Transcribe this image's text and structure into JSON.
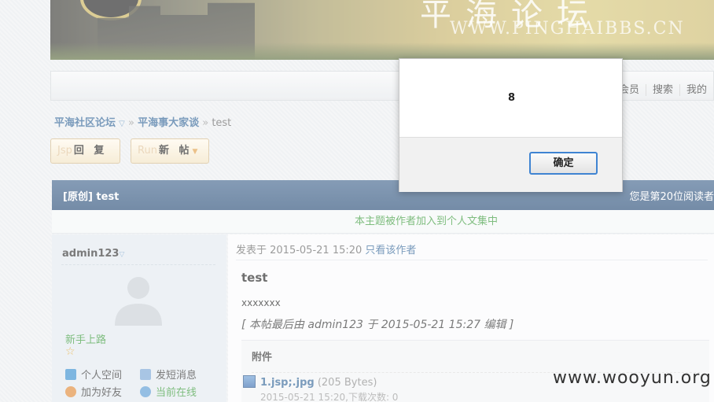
{
  "banner": {
    "site_url": "WWW.PINGHAIBBS.CN",
    "logo_text": "平海论坛"
  },
  "navbar": {
    "links": [
      "会员",
      "搜索",
      "我的"
    ]
  },
  "breadcrumb": {
    "forum": "平海社区论坛",
    "sep1": " » ",
    "board": "平海事大家谈",
    "sep2": " » ",
    "current": "test"
  },
  "buttons": {
    "reply": {
      "prefix": "Jsp",
      "label": "回 复"
    },
    "new_post": {
      "prefix": "Run",
      "label": "新 帖"
    }
  },
  "topic": {
    "title": "[原创] test",
    "reader_info": "您是第20位阅读者"
  },
  "notice": "本主题被作者加入到个人文集中",
  "author": {
    "name": "admin123",
    "rank": "新手上路",
    "actions": [
      "个人空间",
      "发短消息",
      "加为好友",
      "当前在线"
    ]
  },
  "post": {
    "posted_at": "发表于 2015-05-21 15:20",
    "only_author_link": "只看该作者",
    "title": "test",
    "body": "xxxxxxx",
    "edit_note": "[ 本帖最后由 admin123 于 2015-05-21  15:27 编辑 ]",
    "attachments_heading": "附件",
    "attachment": {
      "filename": "1.jsp;.jpg",
      "size": "(205 Bytes)",
      "info": "2015-05-21 15:20,下载次数: 0"
    }
  },
  "dialog": {
    "message": "8",
    "ok_label": "确定"
  },
  "watermark": "www.wooyun.org",
  "colors": {
    "topic_bar": "#2a4e78",
    "link": "#336699",
    "green_text": "#3a9a3a",
    "dialog_focus": "#3f84d2"
  }
}
